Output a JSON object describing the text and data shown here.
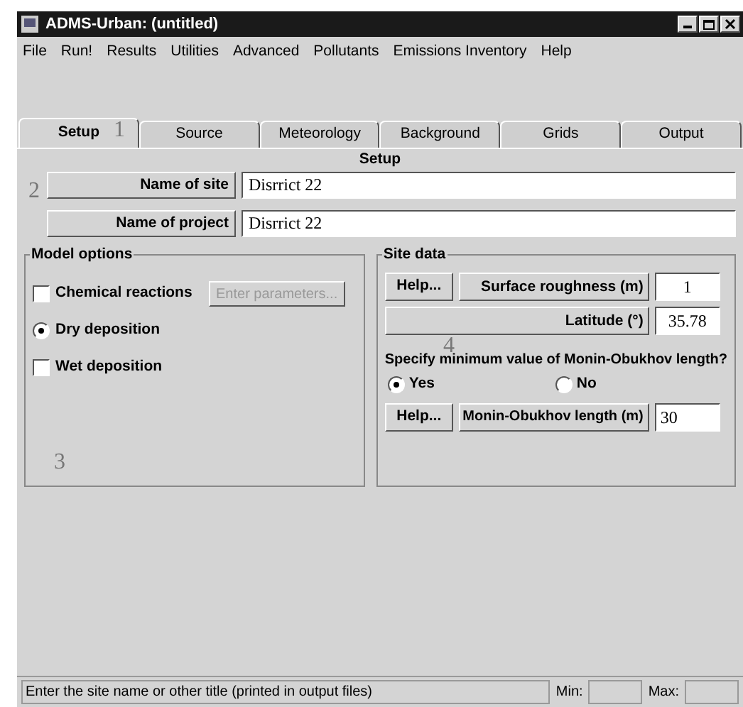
{
  "window": {
    "title": "ADMS-Urban: (untitled)"
  },
  "menu": [
    "File",
    "Run!",
    "Results",
    "Utilities",
    "Advanced",
    "Pollutants",
    "Emissions Inventory",
    "Help"
  ],
  "tabs": [
    {
      "label": "Setup",
      "selected": true
    },
    {
      "label": "Source",
      "selected": false
    },
    {
      "label": "Meteorology",
      "selected": false
    },
    {
      "label": "Background",
      "selected": false
    },
    {
      "label": "Grids",
      "selected": false
    },
    {
      "label": "Output",
      "selected": false
    }
  ],
  "page_title": "Setup",
  "name_fields": [
    {
      "label": "Name of site",
      "value": "Disrrict 22"
    },
    {
      "label": "Name of project",
      "value": "Disrrict 22"
    }
  ],
  "model_options": {
    "title": "Model options",
    "items": [
      {
        "kind": "checkbox",
        "label": "Chemical reactions",
        "checked": false
      },
      {
        "kind": "radio",
        "label": "Dry deposition",
        "checked": true
      },
      {
        "kind": "checkbox",
        "label": "Wet deposition",
        "checked": false
      }
    ],
    "parameters_button": {
      "label": "Enter parameters...",
      "disabled": true
    }
  },
  "site_data": {
    "title": "Site data",
    "help_button": "Help...",
    "roughness_label": "Surface roughness (m)",
    "roughness_value": "1",
    "latitude_label": "Latitude (°)",
    "latitude_value": "35.78",
    "question": "Specify minimum value of Monin-Obukhov length?",
    "choices": [
      {
        "label": "Yes",
        "selected": true
      },
      {
        "label": "No",
        "selected": false
      }
    ],
    "help_button_2": "Help...",
    "length_label": "Monin-Obukhov length (m)",
    "length_value": "30"
  },
  "status_bar": {
    "message": "Enter the site name or other title (printed in output files)",
    "min_label": "Min:",
    "max_label": "Max:"
  },
  "annotations": [
    "1",
    "2",
    "3",
    "4"
  ]
}
